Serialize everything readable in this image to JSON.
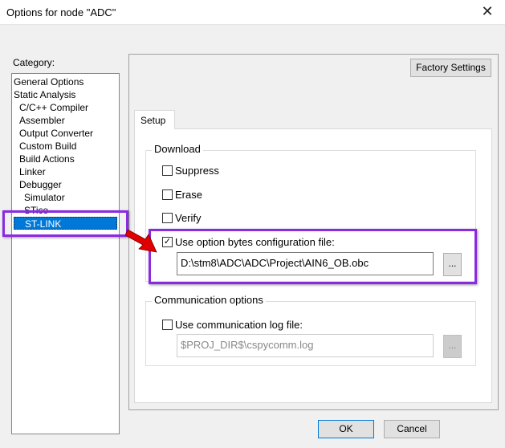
{
  "window": {
    "title": "Options for node \"ADC\"",
    "close": "✕"
  },
  "category": {
    "label": "Category:",
    "items": [
      {
        "label": "General Options",
        "indent": 0
      },
      {
        "label": "Static Analysis",
        "indent": 0
      },
      {
        "label": "C/C++ Compiler",
        "indent": 1
      },
      {
        "label": "Assembler",
        "indent": 1
      },
      {
        "label": "Output Converter",
        "indent": 1
      },
      {
        "label": "Custom Build",
        "indent": 1
      },
      {
        "label": "Build Actions",
        "indent": 1
      },
      {
        "label": "Linker",
        "indent": 1
      },
      {
        "label": "Debugger",
        "indent": 1
      },
      {
        "label": "Simulator",
        "indent": 2
      },
      {
        "label": "STice",
        "indent": 2
      },
      {
        "label": "ST-LINK",
        "indent": 2,
        "selected": true
      }
    ]
  },
  "factory_settings": "Factory Settings",
  "tabs": [
    {
      "label": "Setup",
      "active": true
    }
  ],
  "download": {
    "label": "Download",
    "suppress": {
      "label": "Suppress",
      "checked": false
    },
    "erase": {
      "label": "Erase",
      "checked": false
    },
    "verify": {
      "label": "Verify",
      "checked": false
    },
    "option_bytes": {
      "label": "Use option bytes configuration file:",
      "checked": true,
      "value": "D:\\stm8\\ADC\\ADC\\Project\\AIN6_OB.obc",
      "browse": "..."
    }
  },
  "communication": {
    "label": "Communication options",
    "log": {
      "label": "Use communication log file:",
      "checked": false,
      "value": "$PROJ_DIR$\\cspycomm.log",
      "browse": "..."
    }
  },
  "footer": {
    "ok": "OK",
    "cancel": "Cancel"
  },
  "colors": {
    "selection": "#0078d7",
    "annotation": "#8a2be2",
    "arrow": "#e00000"
  }
}
